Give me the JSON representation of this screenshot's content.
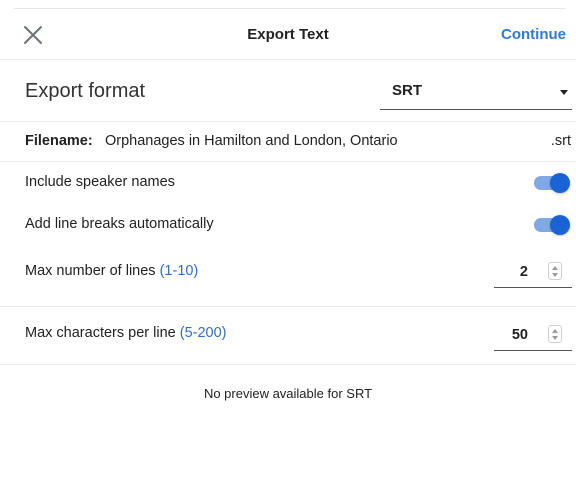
{
  "header": {
    "title": "Export Text",
    "continue_label": "Continue",
    "close_icon": "close-icon"
  },
  "format": {
    "label": "Export format",
    "selected": "SRT",
    "dropdown_icon": "chevron-down-icon"
  },
  "filename": {
    "label": "Filename:",
    "value": "Orphanages in Hamilton and London, Ontario",
    "extension": ".srt"
  },
  "options": {
    "speaker_names": {
      "label": "Include speaker names",
      "enabled": true
    },
    "line_breaks": {
      "label": "Add line breaks automatically",
      "enabled": true
    }
  },
  "max_lines": {
    "label": "Max number of lines",
    "range": "(1-10)",
    "value": "2"
  },
  "max_chars": {
    "label": "Max characters per line",
    "range": "(5-200)",
    "value": "50"
  },
  "preview": {
    "message": "No preview available for SRT"
  },
  "colors": {
    "accent": "#2f7bd6",
    "toggle_knob": "#1a63d4",
    "toggle_track": "#7ea9e6",
    "range_text": "#2f6fc4"
  }
}
